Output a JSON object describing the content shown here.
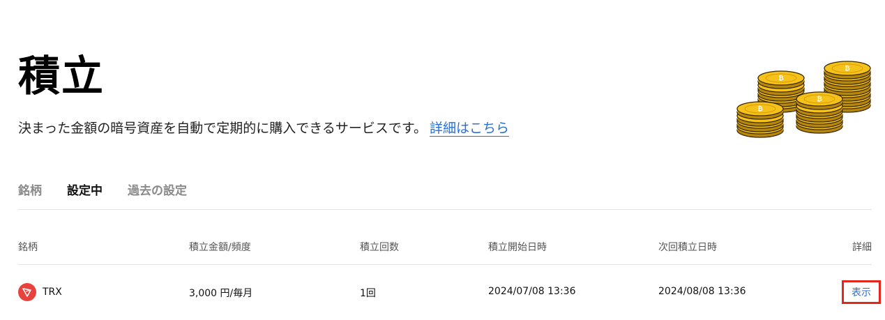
{
  "page": {
    "title": "積立",
    "description": "決まった金額の暗号資産を自動で定期的に購入できるサービスです。",
    "detail_link": "詳細はこちら"
  },
  "tabs": [
    {
      "label": "銘柄",
      "active": false
    },
    {
      "label": "設定中",
      "active": true
    },
    {
      "label": "過去の設定",
      "active": false
    }
  ],
  "table": {
    "headers": [
      "銘柄",
      "積立金額/頻度",
      "積立回数",
      "積立開始日時",
      "次回積立日時",
      "詳細"
    ],
    "rows": [
      {
        "asset": "TRX",
        "asset_icon": "tron-icon",
        "amount_frequency": "3,000 円/毎月",
        "count": "1回",
        "start_datetime": "2024/07/08 13:36",
        "next_datetime": "2024/08/08 13:36",
        "detail_label": "表示"
      }
    ]
  },
  "colors": {
    "link": "#2a6fd6",
    "highlight_border": "#e5261b",
    "trx_red": "#e8423d",
    "coin_gold": "#f2b705"
  },
  "illustration": "gold-bitcoin-coin-stacks"
}
